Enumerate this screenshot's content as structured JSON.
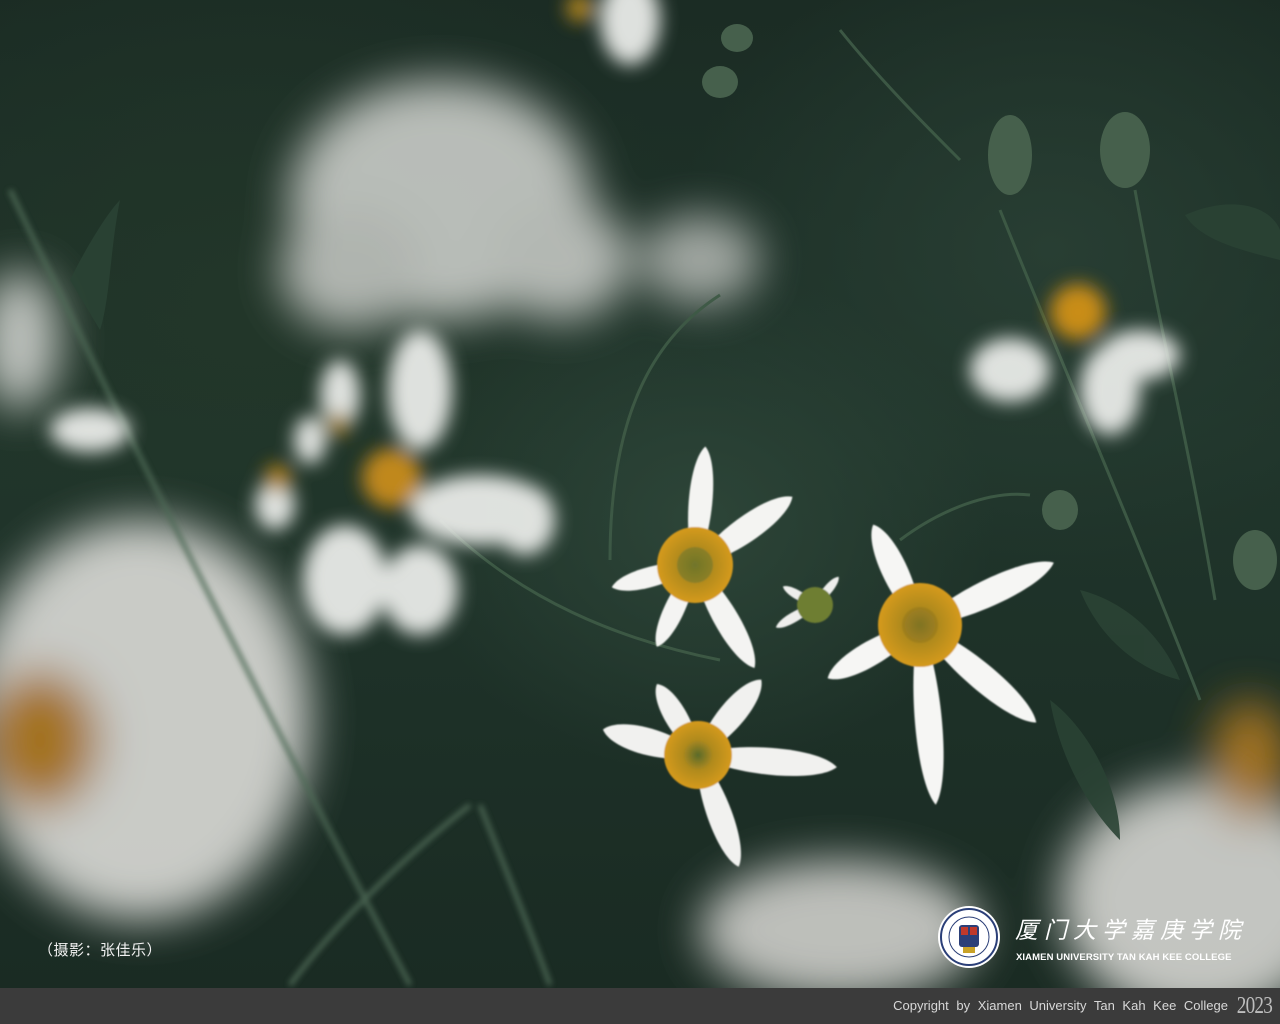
{
  "photo": {
    "subject": "white-daisy-flowers-icon",
    "caption": "（摄影：张佳乐）"
  },
  "brand": {
    "logo": "college-seal-icon",
    "name_cn": "厦门大学嘉庚学院",
    "name_en": "XIAMEN UNIVERSITY TAN KAH KEE COLLEGE"
  },
  "footer": {
    "copyright": "Copyright by Xiamen University Tan Kah Kee College",
    "year": "2023"
  },
  "colors": {
    "background": "#1f3329",
    "petal": "#f4f4f2",
    "flower_center": "#c8901a",
    "footer_bar": "#3b3b3b"
  }
}
